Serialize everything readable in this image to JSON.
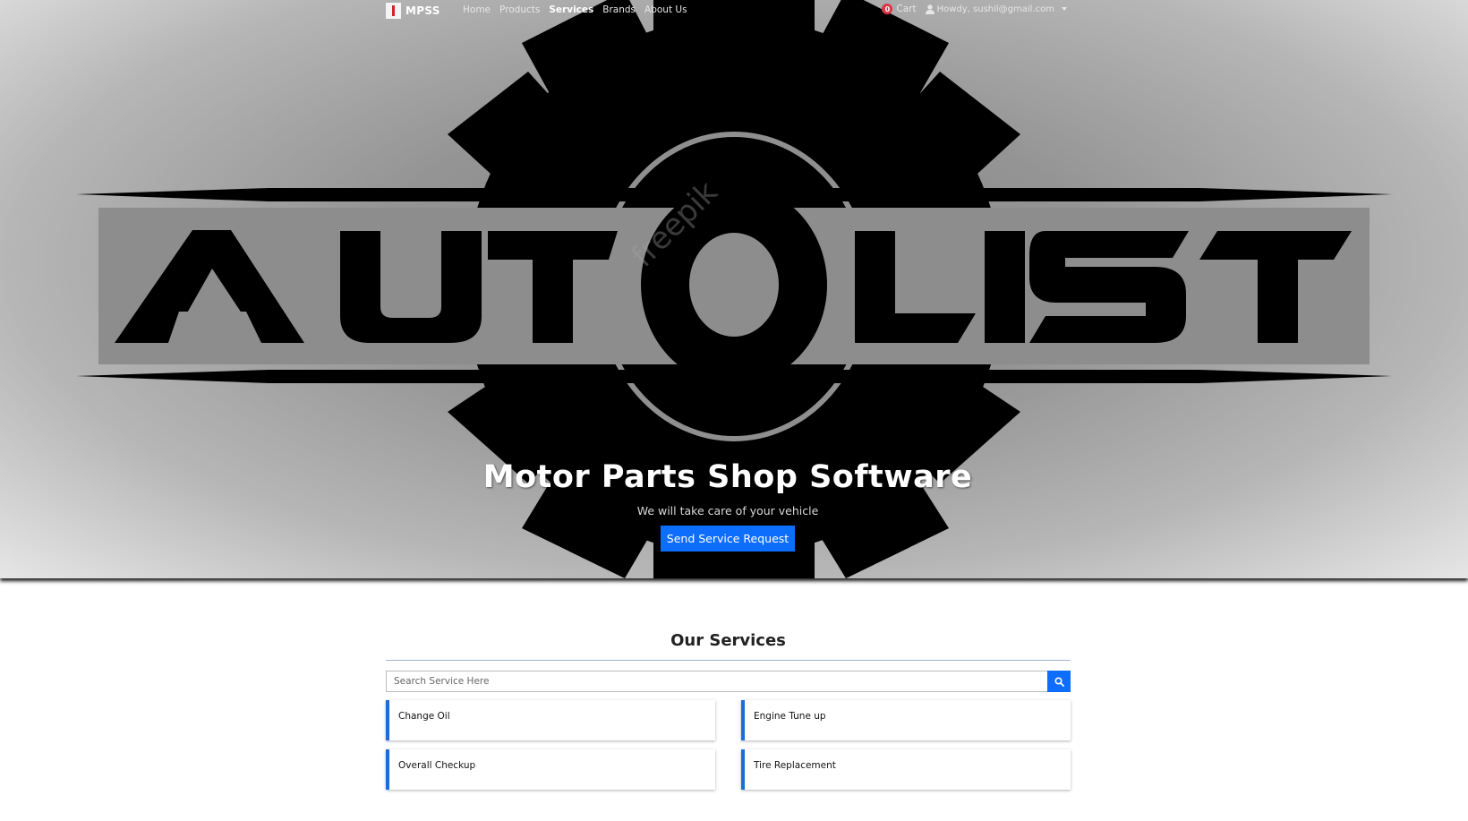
{
  "navbar": {
    "brand": "MPSS",
    "links": [
      {
        "label": "Home"
      },
      {
        "label": "Products"
      },
      {
        "label": "Services"
      },
      {
        "label": "Brands"
      },
      {
        "label": "About Us"
      }
    ],
    "active_link": "Services",
    "cart_count": "0",
    "cart_label": "Cart",
    "user_label": "Howdy, sushil@gmail.com"
  },
  "hero": {
    "logo_text": "AUTOLIST",
    "watermark": "freepik",
    "title": "Motor Parts Shop Software",
    "subtitle": "We will take care of your vehicle",
    "button_label": "Send Service Request",
    "accent_color": "#0d6efd"
  },
  "services": {
    "heading": "Our Services",
    "search_placeholder": "Search Service Here",
    "search_icon": "search-icon",
    "items": [
      {
        "label": "Change Oil"
      },
      {
        "label": "Engine Tune up"
      },
      {
        "label": "Overall Checkup"
      },
      {
        "label": "Tire Replacement"
      }
    ],
    "card_accent": "#1b6ed8"
  }
}
